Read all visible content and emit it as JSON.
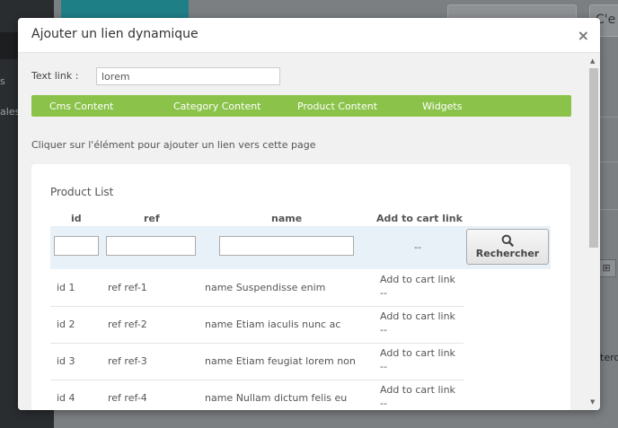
{
  "background": {
    "sidebar_items": [
      "s",
      "ales"
    ],
    "header_button_label": "C'e",
    "toolbar_icon": "grid-icon",
    "side_text": "terc"
  },
  "modal": {
    "title": "Ajouter un lien dynamique",
    "close_label": "×",
    "text_link_label": "Text link :",
    "text_link_value": "lorem",
    "tabs": [
      {
        "label": "Cms Content"
      },
      {
        "label": "Category Content"
      },
      {
        "label": "Product Content"
      },
      {
        "label": "Widgets"
      }
    ],
    "help_text": "Cliquer sur l'élément pour ajouter un lien vers cette page",
    "panel_title": "Product List",
    "columns": {
      "id": "id",
      "ref": "ref",
      "name": "name",
      "cart": "Add to cart link"
    },
    "filter": {
      "dash": "--",
      "search_label": "Rechercher",
      "search_icon": "magnifier-icon"
    },
    "rows": [
      {
        "id": "id 1",
        "ref": "ref ref-1",
        "name": "name Suspendisse enim",
        "cart": "Add to cart link",
        "cart_sub": "--"
      },
      {
        "id": "id 2",
        "ref": "ref ref-2",
        "name": "name Etiam iaculis nunc ac",
        "cart": "Add to cart link",
        "cart_sub": "--"
      },
      {
        "id": "id 3",
        "ref": "ref ref-3",
        "name": "name Etiam feugiat lorem non",
        "cart": "Add to cart link",
        "cart_sub": "--"
      },
      {
        "id": "id 4",
        "ref": "ref ref-4",
        "name": "name Nullam dictum felis eu",
        "cart": "Add to cart link",
        "cart_sub": "--"
      }
    ]
  },
  "colors": {
    "tab_bar": "#8bc34a",
    "filter_row": "#e8f1f8",
    "overlay": "#7c7f82"
  }
}
